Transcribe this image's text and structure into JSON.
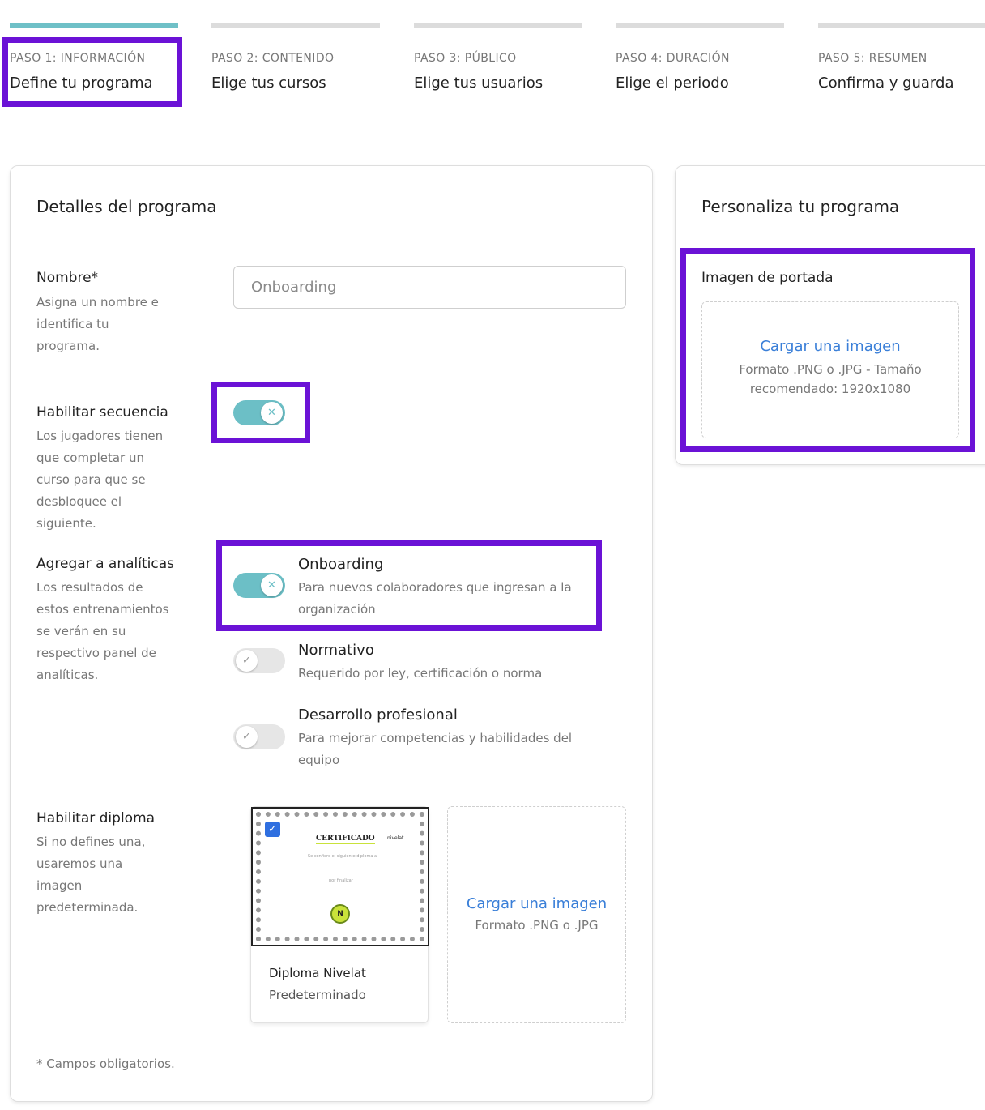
{
  "stepper": [
    {
      "label": "PASO 1: INFORMACIÓN",
      "subtitle": "Define tu programa",
      "active": true
    },
    {
      "label": "PASO 2: CONTENIDO",
      "subtitle": "Elige tus cursos",
      "active": false
    },
    {
      "label": "PASO 3: PÚBLICO",
      "subtitle": "Elige tus usuarios",
      "active": false
    },
    {
      "label": "PASO 4: DURACIÓN",
      "subtitle": "Elige el periodo",
      "active": false
    },
    {
      "label": "PASO 5: RESUMEN",
      "subtitle": "Confirma y guarda",
      "active": false
    }
  ],
  "details": {
    "title": "Detalles del programa",
    "name": {
      "title": "Nombre*",
      "desc": "Asigna un nombre e identifica tu programa.",
      "value": "Onboarding"
    },
    "sequence": {
      "title": "Habilitar secuencia",
      "desc": "Los jugadores tienen que completar un curso para que se desbloquee el siguiente.",
      "enabled": true
    },
    "analytics": {
      "title": "Agregar a analíticas",
      "desc": "Los resultados de estos entrenamientos se verán en su respectivo panel de analíticas.",
      "options": [
        {
          "title": "Onboarding",
          "desc": "Para nuevos colaboradores que ingresan a la organización",
          "enabled": true
        },
        {
          "title": "Normativo",
          "desc": "Requerido por ley, certificación o norma",
          "enabled": false
        },
        {
          "title": "Desarrollo profesional",
          "desc": "Para mejorar competencias y habilidades del equipo",
          "enabled": false
        }
      ]
    },
    "diploma": {
      "title": "Habilitar diploma",
      "desc": "Si no defines una, usaremos una imagen predeterminada.",
      "card": {
        "name": "Diploma Nivelat",
        "tag": "Predeterminado",
        "cert_title": "CERTIFICADO",
        "cert_brand": "nivelat",
        "cert_line1": "Se confiere el siguiente diploma a",
        "cert_line2": "por finalizar",
        "seal": "N"
      },
      "upload": {
        "link": "Cargar una imagen",
        "hint": "Formato .PNG o .JPG"
      }
    },
    "footnote": "* Campos obligatorios."
  },
  "customize": {
    "title": "Personaliza tu programa",
    "cover_label": "Imagen de portada",
    "upload_link": "Cargar una imagen",
    "upload_hint": "Formato .PNG o .JPG - Tamaño recomendado: 1920x1080"
  },
  "colors": {
    "accent": "#6cbfc6",
    "highlight": "#6b12d6",
    "link": "#3a7fd8"
  }
}
